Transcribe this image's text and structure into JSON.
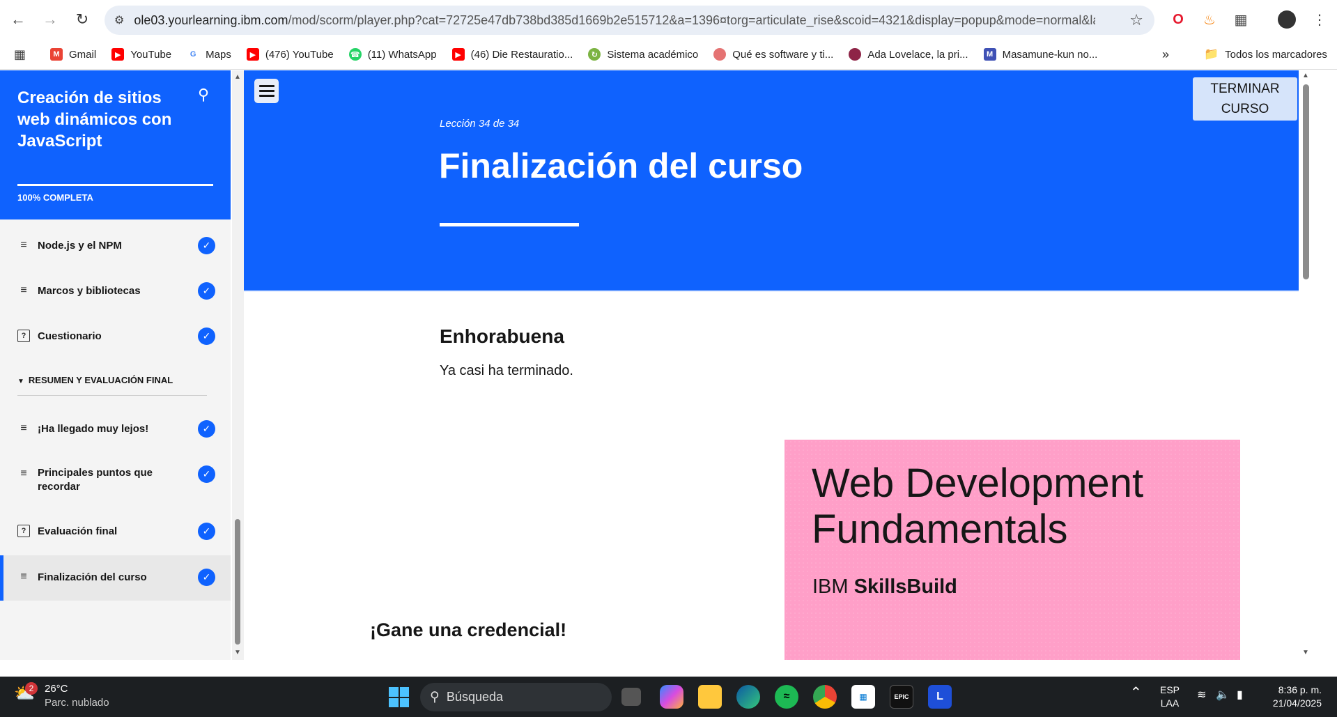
{
  "browser": {
    "url_host": "ole03.yourlearning.ibm.com",
    "url_rest": "/mod/scorm/player.php?cat=72725e47db738bd385d1669b2e515712&a=1396¤torg=articulate_rise&scoid=4321&display=popup&mode=normal&lang...",
    "bookmarks": [
      {
        "label": "Gmail",
        "icon": "gmail-icon",
        "color": "#ea4335"
      },
      {
        "label": "YouTube",
        "icon": "youtube-icon",
        "color": "#ff0000"
      },
      {
        "label": "Maps",
        "icon": "google-icon",
        "color": "#4285f4"
      },
      {
        "label": "(476) YouTube",
        "icon": "youtube-icon",
        "color": "#ff0000"
      },
      {
        "label": "(11) WhatsApp",
        "icon": "whatsapp-icon",
        "color": "#25d366"
      },
      {
        "label": "(46) Die Restauratio...",
        "icon": "youtube-icon",
        "color": "#ff0000"
      },
      {
        "label": "Sistema académico",
        "icon": "sistema-icon",
        "color": "#7cb342"
      },
      {
        "label": "Qué es software y ti...",
        "icon": "site-icon",
        "color": "#e57373"
      },
      {
        "label": "Ada Lovelace, la pri...",
        "icon": "site-icon",
        "color": "#8e2447"
      },
      {
        "label": "Masamune-kun no...",
        "icon": "site-icon",
        "color": "#3f51b5"
      }
    ],
    "all_bookmarks": "Todos los marcadores"
  },
  "sidebar": {
    "course_title": "Creación de sitios web dinámicos con JavaScript",
    "progress": "100% COMPLETA",
    "items": [
      {
        "label": "Node.js y el NPM",
        "type": "lesson"
      },
      {
        "label": "Marcos y bibliotecas",
        "type": "lesson"
      },
      {
        "label": "Cuestionario",
        "type": "quiz"
      },
      {
        "label": "¡Ha llegado muy lejos!",
        "type": "lesson"
      },
      {
        "label": "Principales puntos que recordar",
        "type": "lesson"
      },
      {
        "label": "Evaluación final",
        "type": "quiz"
      },
      {
        "label": "Finalización del curso",
        "type": "lesson"
      }
    ],
    "section": "RESUMEN Y EVALUACIÓN FINAL"
  },
  "main": {
    "lesson_meta": "Lección 34 de 34",
    "title": "Finalización del curso",
    "finish_button": "TERMINAR CURSO",
    "heading": "Enhorabuena",
    "paragraph": "Ya casi ha terminado.",
    "credential": "¡Gane una credencial!",
    "card": {
      "title": "Web Development Fundamentals",
      "brand_prefix": "IBM",
      "brand_name": "SkillsBuild",
      "color": "#ff9fc8"
    },
    "accent_color": "#0f62fe"
  },
  "taskbar": {
    "temperature": "26°C",
    "weather": "Parc. nublado",
    "weather_badge": "2",
    "search": "Búsqueda",
    "language": "ESP",
    "layout": "LAA",
    "time": "8:36 p. m.",
    "date": "21/04/2025"
  }
}
